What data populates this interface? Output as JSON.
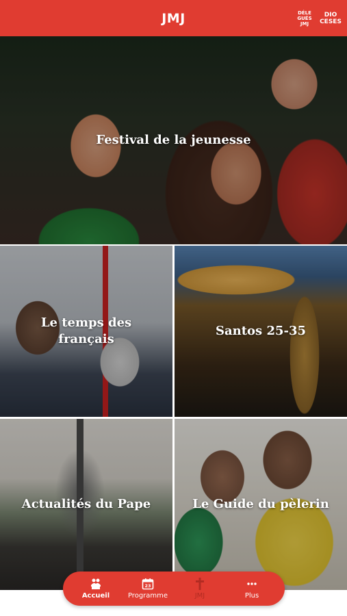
{
  "header": {
    "logo": "JMJ",
    "delegues_label": "DÉLE\nGUÉS\nJMJ",
    "dioceses_label": "DIO\nCESES",
    "background_color": "#e03c31"
  },
  "tiles": [
    {
      "title": "Festival de la jeunesse"
    },
    {
      "title": "Le temps des\nfrançais"
    },
    {
      "title": "Santos 25-35"
    },
    {
      "title": "Actualités du Pape"
    },
    {
      "title": "Le Guide du pèlerin"
    }
  ],
  "tabbar": {
    "items": [
      {
        "label": "Accueil",
        "icon": "home-people-icon",
        "state": "active"
      },
      {
        "label": "Programme",
        "icon": "calendar-icon",
        "state": "normal"
      },
      {
        "label": "JMJ",
        "icon": "cross-icon",
        "state": "disabled"
      },
      {
        "label": "Plus",
        "icon": "more-icon",
        "state": "normal"
      }
    ],
    "calendar_day": "23"
  }
}
